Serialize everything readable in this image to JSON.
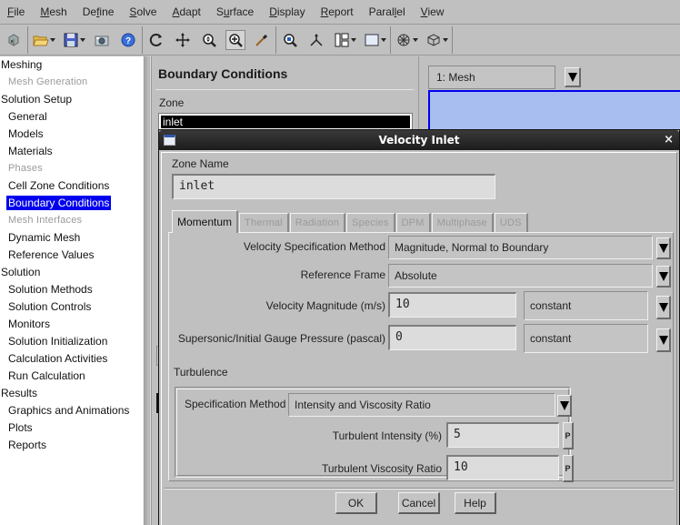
{
  "menu": [
    {
      "label": "File",
      "mnemonic_index": 0
    },
    {
      "label": "Mesh",
      "mnemonic_index": 0
    },
    {
      "label": "Define",
      "mnemonic_index": 2
    },
    {
      "label": "Solve",
      "mnemonic_index": 0
    },
    {
      "label": "Adapt",
      "mnemonic_index": 0
    },
    {
      "label": "Surface",
      "mnemonic_index": 1
    },
    {
      "label": "Display",
      "mnemonic_index": 0
    },
    {
      "label": "Report",
      "mnemonic_index": 0
    },
    {
      "label": "Parallel",
      "mnemonic_index": 5
    },
    {
      "label": "View",
      "mnemonic_index": 0
    }
  ],
  "toolbar": {
    "groups": [
      [
        "read-case-icon"
      ],
      [
        "open-folder-icon",
        "save-icon",
        "screenshot-icon",
        "help-icon"
      ],
      [
        "rotate-icon",
        "pan-icon",
        "zoom-icon",
        "zoom-box-icon",
        "probe-icon"
      ],
      [
        "fit-view-icon",
        "axes-icon",
        "layout-icon",
        "window-icon"
      ],
      [
        "view-options-icon",
        "camera-icon"
      ]
    ]
  },
  "tree": [
    {
      "label": "Meshing",
      "level": 0,
      "state": "normal"
    },
    {
      "label": "Mesh Generation",
      "level": 1,
      "state": "disabled"
    },
    {
      "label": "Solution Setup",
      "level": 0,
      "state": "normal"
    },
    {
      "label": "General",
      "level": 1,
      "state": "normal"
    },
    {
      "label": "Models",
      "level": 1,
      "state": "normal"
    },
    {
      "label": "Materials",
      "level": 1,
      "state": "normal"
    },
    {
      "label": "Phases",
      "level": 1,
      "state": "disabled"
    },
    {
      "label": "Cell Zone Conditions",
      "level": 1,
      "state": "normal"
    },
    {
      "label": "Boundary Conditions",
      "level": 1,
      "state": "selected"
    },
    {
      "label": "Mesh Interfaces",
      "level": 1,
      "state": "disabled"
    },
    {
      "label": "Dynamic Mesh",
      "level": 1,
      "state": "normal"
    },
    {
      "label": "Reference Values",
      "level": 1,
      "state": "normal"
    },
    {
      "label": "Solution",
      "level": 0,
      "state": "normal"
    },
    {
      "label": "Solution Methods",
      "level": 1,
      "state": "normal"
    },
    {
      "label": "Solution Controls",
      "level": 1,
      "state": "normal"
    },
    {
      "label": "Monitors",
      "level": 1,
      "state": "normal"
    },
    {
      "label": "Solution Initialization",
      "level": 1,
      "state": "normal"
    },
    {
      "label": "Calculation Activities",
      "level": 1,
      "state": "normal"
    },
    {
      "label": "Run Calculation",
      "level": 1,
      "state": "normal"
    },
    {
      "label": "Results",
      "level": 0,
      "state": "normal"
    },
    {
      "label": "Graphics and Animations",
      "level": 1,
      "state": "normal"
    },
    {
      "label": "Plots",
      "level": 1,
      "state": "normal"
    },
    {
      "label": "Reports",
      "level": 1,
      "state": "normal"
    }
  ],
  "boundary_panel": {
    "title": "Boundary Conditions",
    "zone_label": "Zone",
    "zones": [
      "inlet"
    ],
    "selected_zone": "inlet"
  },
  "graphics": {
    "window_select": "1: Mesh",
    "colors": {
      "canvas": "#a8bef0",
      "border": "#0000ee"
    }
  },
  "dialog": {
    "title": "Velocity Inlet",
    "close_label": "×",
    "zone_name_label": "Zone Name",
    "zone_name_value": "inlet",
    "tabs": [
      {
        "label": "Momentum",
        "active": true
      },
      {
        "label": "Thermal",
        "active": false
      },
      {
        "label": "Radiation",
        "active": false
      },
      {
        "label": "Species",
        "active": false
      },
      {
        "label": "DPM",
        "active": false
      },
      {
        "label": "Multiphase",
        "active": false
      },
      {
        "label": "UDS",
        "active": false
      }
    ],
    "momentum": {
      "velocity_spec_label": "Velocity Specification Method",
      "velocity_spec_value": "Magnitude, Normal to Boundary",
      "reference_frame_label": "Reference Frame",
      "reference_frame_value": "Absolute",
      "velocity_magnitude_label": "Velocity Magnitude (m/s)",
      "velocity_magnitude_value": "10",
      "velocity_magnitude_profile": "constant",
      "gauge_pressure_label": "Supersonic/Initial Gauge Pressure (pascal)",
      "gauge_pressure_value": "0",
      "gauge_pressure_profile": "constant"
    },
    "turbulence": {
      "section_label": "Turbulence",
      "spec_method_label": "Specification Method",
      "spec_method_value": "Intensity and Viscosity Ratio",
      "intensity_label": "Turbulent Intensity (%)",
      "intensity_value": "5",
      "viscosity_ratio_label": "Turbulent Viscosity Ratio",
      "viscosity_ratio_value": "10",
      "param_button_label": "P"
    },
    "buttons": {
      "ok": "OK",
      "cancel": "Cancel",
      "help": "Help"
    }
  }
}
